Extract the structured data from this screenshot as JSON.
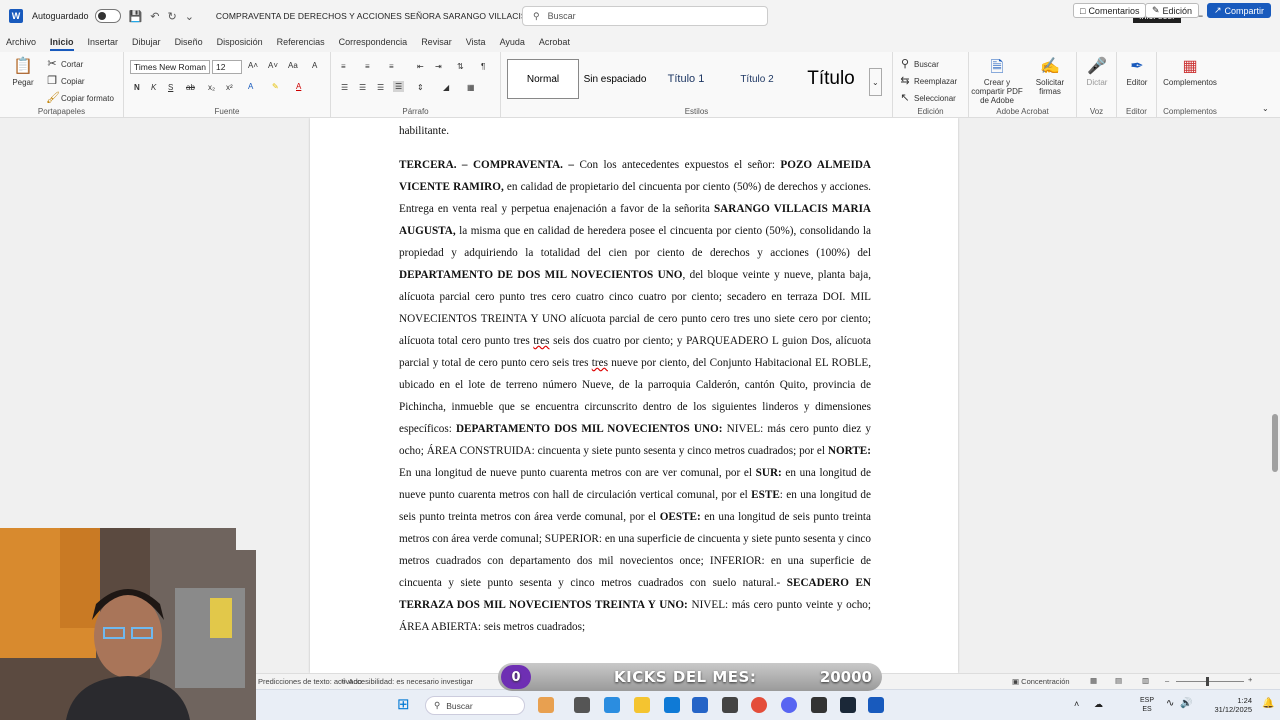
{
  "titlebar": {
    "autosave_label": "Autoguardado",
    "document_title": "COMPRAVENTA DE DERECHOS Y ACCIONES SEÑORA SARANGO VILLACIS",
    "search_placeholder": "Buscar",
    "signin_label": "Inic. ses."
  },
  "menu": {
    "tabs": [
      "Archivo",
      "Inicio",
      "Insertar",
      "Dibujar",
      "Diseño",
      "Disposición",
      "Referencias",
      "Correspondencia",
      "Revisar",
      "Vista",
      "Ayuda",
      "Acrobat"
    ],
    "active_tab": "Inicio",
    "comments_label": "Comentarios",
    "editing_label": "Edición",
    "share_label": "Compartir"
  },
  "ribbon": {
    "clipboard": {
      "paste": "Pegar",
      "cut": "Cortar",
      "copy": "Copiar",
      "format_painter": "Copiar formato",
      "label": "Portapapeles"
    },
    "font": {
      "family": "Times New Roman",
      "size": "12",
      "label": "Fuente"
    },
    "paragraph": {
      "label": "Párrafo"
    },
    "styles": {
      "items": [
        "Normal",
        "Sin espaciado",
        "Título 1",
        "Título 2",
        "Título"
      ],
      "label": "Estilos"
    },
    "editing": {
      "find": "Buscar",
      "replace": "Reemplazar",
      "select": "Seleccionar",
      "label": "Edición"
    },
    "adobe": {
      "create": "Crear y compartir PDF de Adobe",
      "request": "Solicitar firmas",
      "label": "Adobe Acrobat"
    },
    "voice": {
      "dictate": "Dictar",
      "label": "Voz"
    },
    "editor": {
      "button": "Editor",
      "label": "Editor"
    },
    "complements": {
      "button": "Complementos",
      "label": "Complementos"
    }
  },
  "document": {
    "line_top": "habilitante.",
    "p1": "Con los antecedentes expuestos el señor: ",
    "p1_head": "TERCERA. – COMPRAVENTA. –",
    "p1_name": "POZO ALMEIDA VICENTE RAMIRO,",
    "p1_b": " en calidad de propietario del cincuenta por ciento (50%) de derechos y acciones. Entrega en venta real y perpetua enajenación a favor de la señorita ",
    "p1_name2": "SARANGO VILLACIS MARIA AUGUSTA,",
    "p1_c": " la misma que en calidad de heredera posee el cincuenta por ciento (50%), consolidando la propiedad y adquiriendo la totalidad del cien por ciento de derechos y acciones (100%) del ",
    "p1_dept": "DEPARTAMENTO DE DOS MIL NOVECIENTOS UNO",
    "p1_d": ", del bloque veinte y nueve, planta baja, alícuota parcial cero punto tres cero cuatro cinco cuatro por ciento; secadero en terraza DOI. MIL NOVECIENTOS TREINTA Y UNO alícuota parcial de cero punto cero tres uno siete cero por ciento; alícuota total cero punto tres ",
    "tres1": "tres",
    "p1_e": " seis dos cuatro por ciento; y PARQUEADERO L guion Dos, alícuota parcial y total de cero punto cero seis tres ",
    "tres2": "tres",
    "p1_f": " nueve por ciento, del Conjunto Habitacional EL ROBLE, ubicado en el lote de terreno número Nueve, de la parroquia Calderón, cantón Quito, provincia de Pichincha, inmueble que se encuentra circunscrito dentro de los siguientes linderos y dimensiones específicos: ",
    "p1_dept2": "DEPARTAMENTO DOS MIL NOVECIENTOS UNO:",
    "p1_g": " NIVEL: más cero punto diez y ocho; ÁREA CONSTRUIDA: cincuenta y siete punto sesenta y cinco metros cuadrados; por el ",
    "norte": "NORTE:",
    "p1_h": " En una longitud de nueve punto cuarenta metros con are ver comunal, por el ",
    "sur": "SUR:",
    "p1_i": " en una longitud de nueve punto cuarenta metros con hall de circulación vertical comunal, por el ",
    "este": "ESTE",
    "p1_j": ": en una longitud de seis punto treinta metros con área verde comunal, por el ",
    "oeste": "OESTE:",
    "p1_k": " en una longitud de seis punto treinta metros con área verde comunal; SUPERIOR: en una superficie de cincuenta y siete punto sesenta y cinco metros cuadrados con departamento dos mil novecientos once; INFERIOR: en una superficie de cincuenta y siete punto sesenta y cinco metros cuadrados con suelo natural.- ",
    "secadero": "SECADERO EN TERRAZA DOS MIL NOVECIENTOS TREINTA Y UNO:",
    "p1_l": " NIVEL: más cero punto veinte y ocho; ÁREA ABIERTA: seis metros cuadrados;"
  },
  "statusbar": {
    "text_prediction": "Predicciones de texto: activado",
    "accessibility": "Accesibilidad: es necesario investigar",
    "focus": "Concentración"
  },
  "overlay": {
    "count": "0",
    "label": "KICKS DEL MES:",
    "value": "20000"
  },
  "taskbar": {
    "search_label": "Buscar",
    "lang1": "ESP",
    "lang2": "ES",
    "time": "1:24",
    "date": "31/12/2025"
  }
}
